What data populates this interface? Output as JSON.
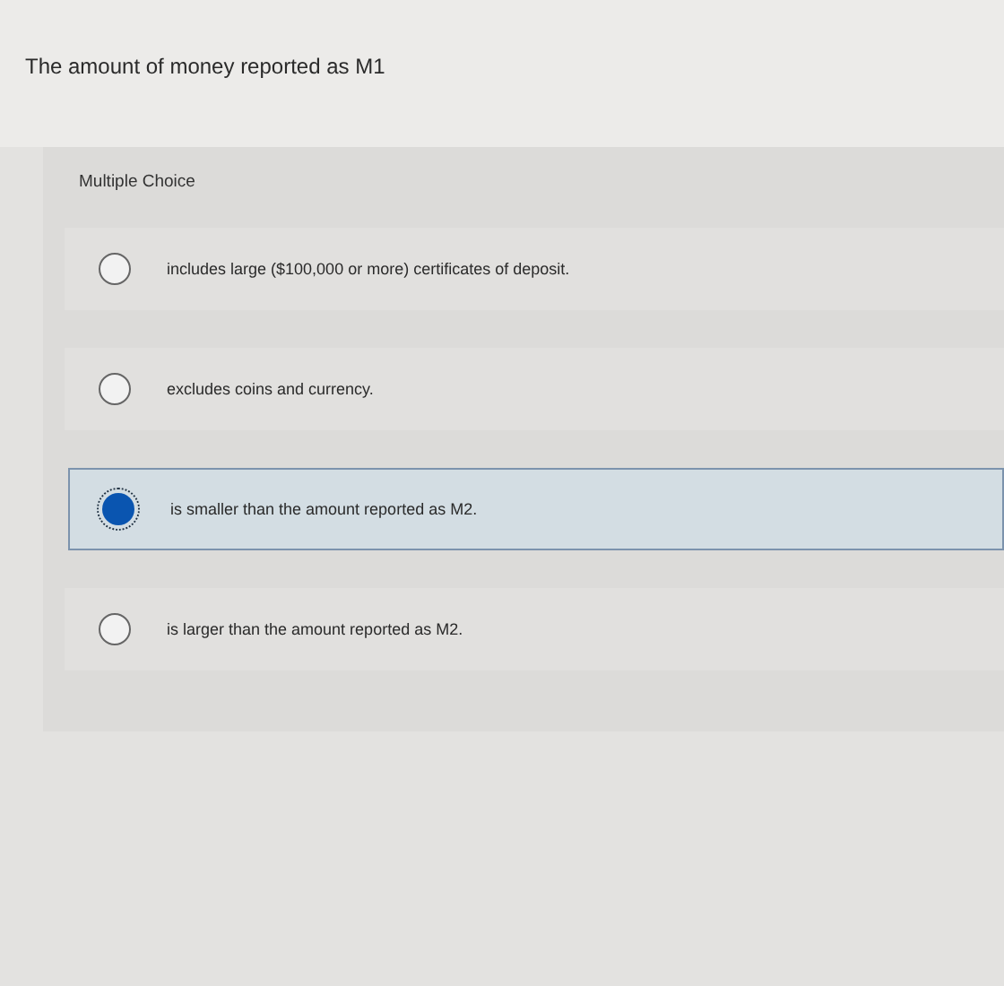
{
  "question": {
    "text": "The amount of money reported as M1"
  },
  "section": {
    "label": "Multiple Choice"
  },
  "options": [
    {
      "text": "includes large ($100,000 or more) certificates of deposit.",
      "selected": false
    },
    {
      "text": "excludes coins and currency.",
      "selected": false
    },
    {
      "text": "is smaller than the amount reported as M2.",
      "selected": true
    },
    {
      "text": "is larger than the amount reported as M2.",
      "selected": false
    }
  ]
}
